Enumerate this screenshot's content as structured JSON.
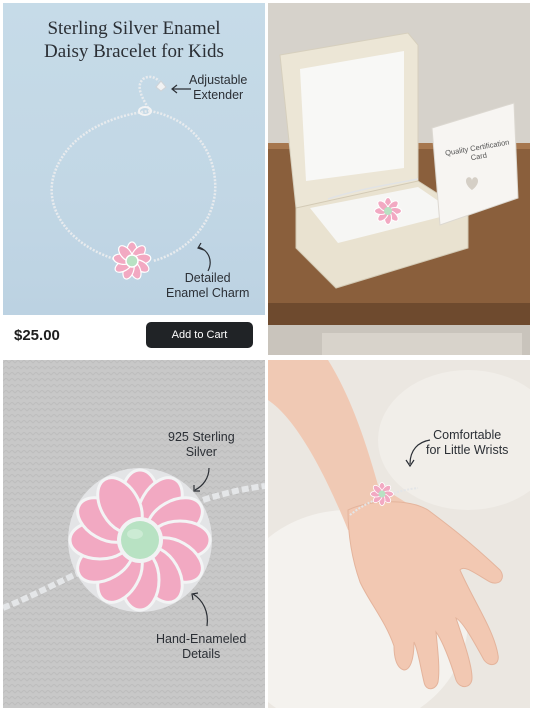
{
  "product": {
    "title_line1": "Sterling Silver Enamel",
    "title_line2": "Daisy Bracelet for Kids",
    "price": "$25.00",
    "add_to_cart_label": "Add to Cart"
  },
  "callouts": {
    "adjustable_1": "Adjustable",
    "adjustable_2": "Extender",
    "charm_1": "Detailed",
    "charm_2": "Enamel Charm",
    "silver_1": "925 Sterling",
    "silver_2": "Silver",
    "enamel_1": "Hand-Enameled",
    "enamel_2": "Details",
    "wrist_1": "Comfortable",
    "wrist_2": "for Little Wrists"
  },
  "certificate": {
    "line1": "Quality Certification",
    "line2": "Card"
  },
  "colors": {
    "petal_pink": "#f2a9c2",
    "center_green": "#b8e2c3",
    "silver": "#d8dce0",
    "button_dark": "#202326"
  }
}
